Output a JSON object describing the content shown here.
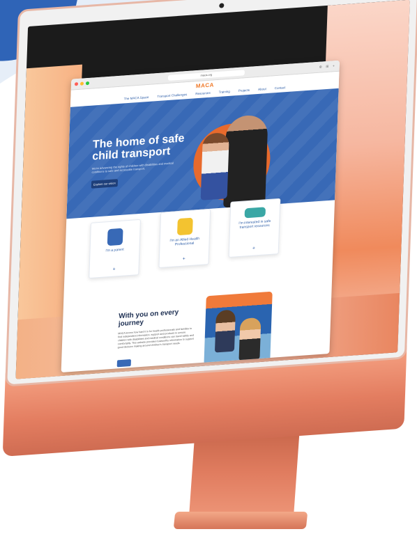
{
  "site": {
    "logo": "MACA",
    "url": "maca.org",
    "nav": [
      "The MACA Space",
      "Transport Challenges",
      "Resources",
      "Training",
      "Projects",
      "About",
      "Contact"
    ]
  },
  "hero": {
    "title": "The home of safe child transport",
    "description": "We're advancing the rights of children with disabilities and medical conditions to safe and accessible transport.",
    "button": "Explore our vision"
  },
  "cards": [
    {
      "label": "I'm a parent",
      "icon": "parent-icon",
      "color": "#3869b6"
    },
    {
      "label": "I'm an Allied Health Professional",
      "icon": "health-professional-icon",
      "color": "#f3c330"
    },
    {
      "label": "I'm interested in safe transport resources",
      "icon": "seatbelt-icon",
      "color": "#3aa7a5"
    }
  ],
  "journey": {
    "title": "With you on every journey",
    "body": "MACA knows how hard it is for health professionals and families to find independent information, support and products to ensure children with disabilities and medical conditions can travel safely and comfortably. This website provides trustworthy information to support good decision making around children's transport needs."
  },
  "colors": {
    "brand_blue": "#3869b6",
    "brand_orange": "#f07a2a",
    "imac_body": "#e37d60"
  }
}
